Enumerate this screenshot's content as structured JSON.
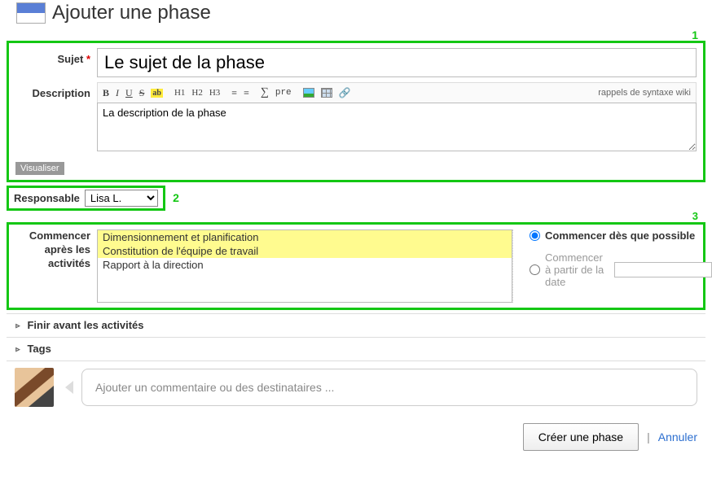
{
  "header": {
    "title": "Ajouter une phase"
  },
  "box1": {
    "num": "1",
    "subjectLabel": "Sujet",
    "subjectValue": "Le sujet de la phase",
    "descriptionLabel": "Description",
    "descriptionValue": "La description de la phase",
    "visualiser": "Visualiser",
    "wikiHint": "rappels de syntaxe wiki",
    "tb": {
      "b": "B",
      "i": "I",
      "u": "U",
      "s": "S",
      "hl": "ab",
      "h1": "H1",
      "h2": "H2",
      "h3": "H3",
      "sum": "∑",
      "pre": "pre"
    }
  },
  "box2": {
    "label": "Responsable",
    "selected": "Lisa L.",
    "num": "2"
  },
  "box3": {
    "num": "3",
    "startAfterLabel": "Commencer après les activités",
    "activities": [
      {
        "label": "Dimensionnement et planification",
        "selected": true
      },
      {
        "label": "Constitution de l'équipe de travail",
        "selected": true
      },
      {
        "label": "Rapport à la direction",
        "selected": false
      }
    ],
    "optAsap": "Commencer dès que possible",
    "optFromDate": "Commencer à partir de la date",
    "selectedOption": "asap"
  },
  "collapsibles": {
    "finishBefore": "Finir avant les activités",
    "tags": "Tags"
  },
  "comment": {
    "placeholder": "Ajouter un commentaire ou des destinataires ..."
  },
  "actions": {
    "create": "Créer une phase",
    "cancel": "Annuler"
  }
}
